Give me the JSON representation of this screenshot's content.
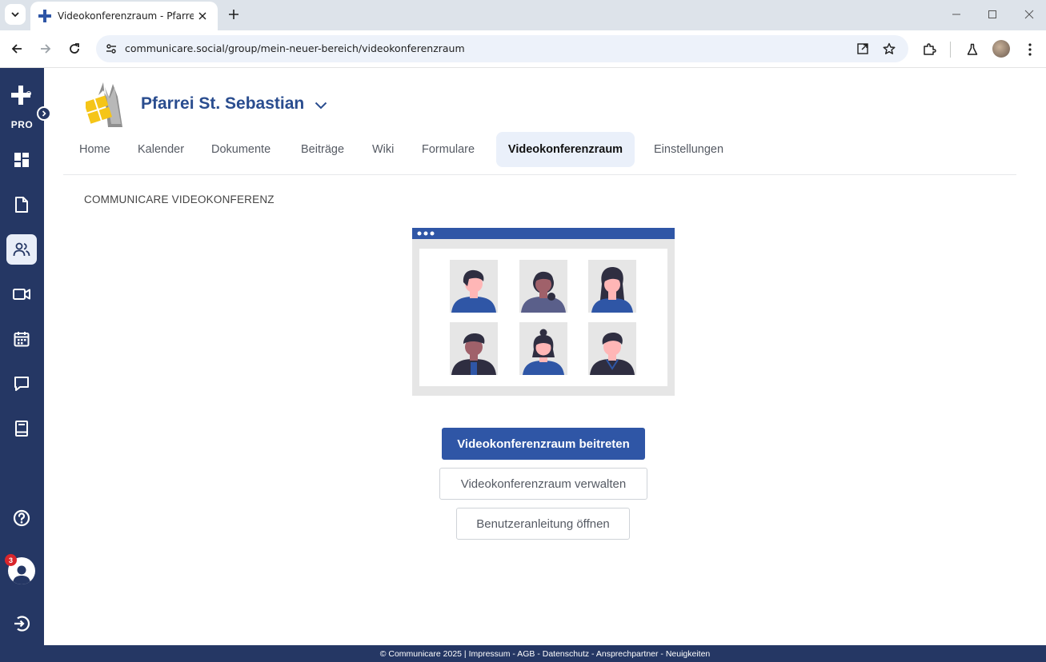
{
  "browser": {
    "tab_title": "Videokonferenzraum - Pfarrei",
    "url": "communicare.social/group/mein-neuer-bereich/videokonferenzraum"
  },
  "sidebar": {
    "pro_label": "PRO",
    "notification_count": "3"
  },
  "group": {
    "title": "Pfarrei St. Sebastian"
  },
  "nav": {
    "tabs": [
      {
        "label": "Home"
      },
      {
        "label": "Kalender"
      },
      {
        "label": "Dokumente"
      },
      {
        "label": "Beiträge"
      },
      {
        "label": "Wiki"
      },
      {
        "label": "Formulare"
      },
      {
        "label": "Videokonferenzraum"
      },
      {
        "label": "Einstellungen"
      }
    ],
    "active": "Videokonferenzraum"
  },
  "content": {
    "section_label": "COMMUNICARE VIDEOKONFERENZ",
    "join_button": "Videokonferenzraum beitreten",
    "manage_button": "Videokonferenzraum verwalten",
    "guide_button": "Benutzeranleitung öffnen"
  },
  "footer": {
    "text": "© Communicare 2025 | Impressum - AGB - Datenschutz - Ansprechpartner - Neuigkeiten"
  },
  "colors": {
    "sidebar_bg": "#253764",
    "primary": "#2f56a6",
    "title": "#2a4d8f",
    "active_tab_bg": "#eaf0fa"
  }
}
